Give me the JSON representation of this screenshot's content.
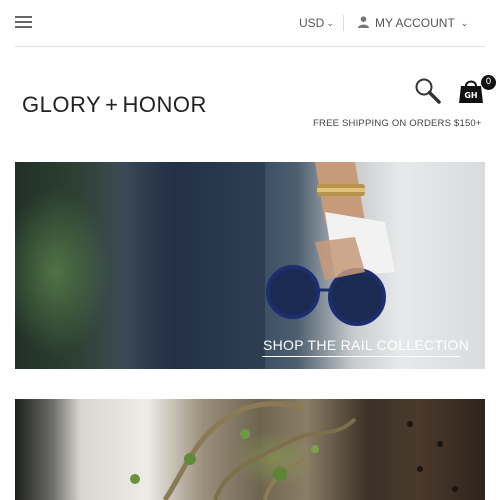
{
  "header": {
    "currency": "USD",
    "account_label": "MY ACCOUNT"
  },
  "brand": {
    "logo_left": "GLORY",
    "logo_mark": "+",
    "logo_right": "HONOR"
  },
  "cart": {
    "count": "0",
    "badge_text": "GH"
  },
  "shipping_notice": "FREE SHIPPING ON ORDERS $150+",
  "banners": [
    {
      "caption": "SHOP THE RAIL COLLECTION"
    },
    {
      "caption": ""
    }
  ],
  "icons": [
    "menu-icon",
    "user-icon",
    "chevron-down-icon",
    "search-icon",
    "cart-icon"
  ]
}
